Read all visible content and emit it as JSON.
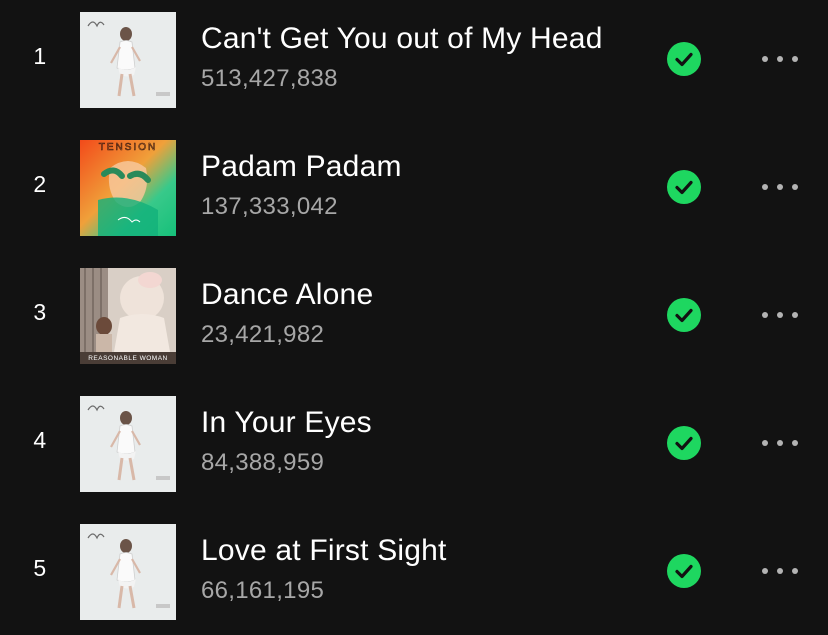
{
  "tracks": [
    {
      "number": "1",
      "title": "Can't Get You out of My Head",
      "plays": "513,427,838",
      "saved": true,
      "cover": "kylie-white"
    },
    {
      "number": "2",
      "title": "Padam Padam",
      "plays": "137,333,042",
      "saved": true,
      "cover": "tension"
    },
    {
      "number": "3",
      "title": "Dance Alone",
      "plays": "23,421,982",
      "saved": true,
      "cover": "reasonable-woman"
    },
    {
      "number": "4",
      "title": "In Your Eyes",
      "plays": "84,388,959",
      "saved": true,
      "cover": "kylie-white"
    },
    {
      "number": "5",
      "title": "Love at First Sight",
      "plays": "66,161,195",
      "saved": true,
      "cover": "kylie-white"
    }
  ],
  "covers": {
    "tension_text": "TENSION",
    "reasonable_text": "REASONABLE WOMAN"
  },
  "colors": {
    "background": "#121212",
    "accent_green": "#1ed760",
    "secondary_text": "#a7a7a7"
  },
  "icons": {
    "saved": "check-circle-icon",
    "more": "more-options-icon"
  }
}
